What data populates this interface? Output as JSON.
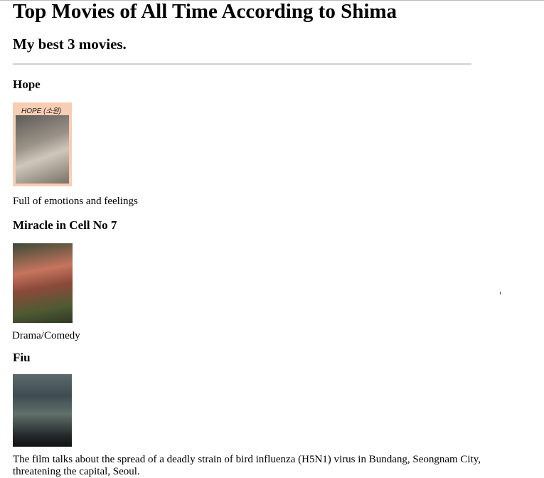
{
  "page": {
    "title": "Top Movies of All Time According to Shima",
    "subtitle": "My best 3 movies."
  },
  "movies": [
    {
      "title": "Hope",
      "poster_text": "HOPE (소원)",
      "description": "Full of emotions and feelings"
    },
    {
      "title": "Miracle in Cell No 7",
      "description": "Drama/Comedy"
    },
    {
      "title": "Fiu",
      "description": "The film talks about the spread of a deadly strain of bird influenza (H5N1) virus in Bundang, Seongnam City, threatening the capital, Seoul."
    }
  ]
}
